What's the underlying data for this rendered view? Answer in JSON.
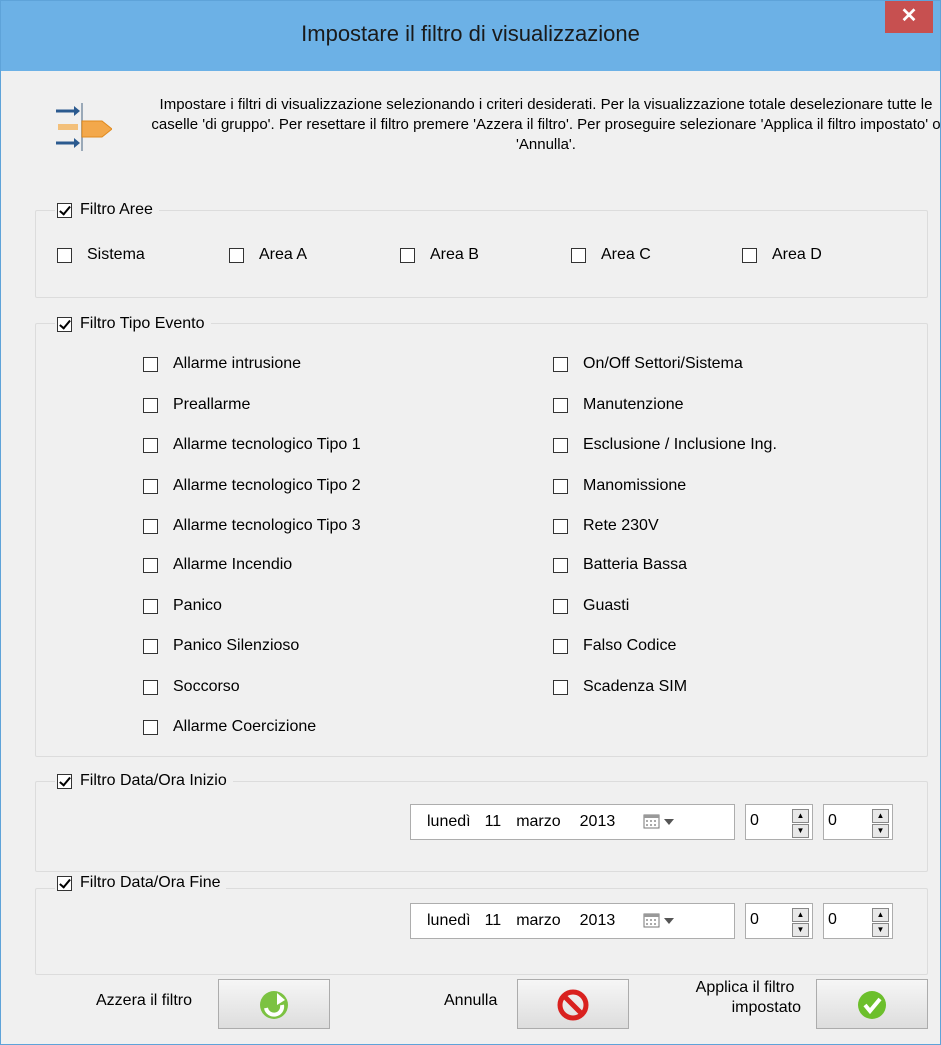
{
  "window": {
    "title": "Impostare il filtro di visualizzazione",
    "close_symbol": "✕"
  },
  "intro": {
    "text": "Impostare i filtri di visualizzazione selezionando i criteri desiderati. Per la visualizzazione totale deselezionare tutte le caselle 'di gruppo'. Per resettare il filtro premere 'Azzera il filtro'. Per proseguire selezionare 'Applica il filtro impostato' o 'Annulla'.",
    "icon": "filter-arrows-icon"
  },
  "filtro_aree": {
    "label": "Filtro Aree",
    "checked": true,
    "items": [
      {
        "label": "Sistema",
        "checked": false
      },
      {
        "label": "Area A",
        "checked": false
      },
      {
        "label": "Area B",
        "checked": false
      },
      {
        "label": "Area C",
        "checked": false
      },
      {
        "label": "Area D",
        "checked": false
      }
    ]
  },
  "filtro_tipo_evento": {
    "label": "Filtro Tipo Evento",
    "checked": true,
    "left_items": [
      {
        "label": "Allarme intrusione",
        "checked": false
      },
      {
        "label": "Preallarme",
        "checked": false
      },
      {
        "label": "Allarme tecnologico Tipo 1",
        "checked": false
      },
      {
        "label": "Allarme tecnologico Tipo 2",
        "checked": false
      },
      {
        "label": "Allarme tecnologico Tipo 3",
        "checked": false
      },
      {
        "label": "Allarme Incendio",
        "checked": false
      },
      {
        "label": "Panico",
        "checked": false
      },
      {
        "label": "Panico Silenzioso",
        "checked": false
      },
      {
        "label": "Soccorso",
        "checked": false
      },
      {
        "label": "Allarme Coercizione",
        "checked": false
      }
    ],
    "right_items": [
      {
        "label": "On/Off Settori/Sistema",
        "checked": false
      },
      {
        "label": "Manutenzione",
        "checked": false
      },
      {
        "label": "Esclusione / Inclusione Ing.",
        "checked": false
      },
      {
        "label": "Manomissione",
        "checked": false
      },
      {
        "label": "Rete 230V",
        "checked": false
      },
      {
        "label": "Batteria Bassa",
        "checked": false
      },
      {
        "label": "Guasti",
        "checked": false
      },
      {
        "label": "Falso Codice",
        "checked": false
      },
      {
        "label": "Scadenza SIM",
        "checked": false
      }
    ]
  },
  "filtro_inizio": {
    "label": "Filtro Data/Ora Inizio",
    "checked": true,
    "weekday": "lunedì",
    "day": "11",
    "month": "marzo",
    "year": "2013",
    "hour": "0",
    "minute": "0"
  },
  "filtro_fine": {
    "label": "Filtro Data/Ora Fine",
    "checked": true,
    "weekday": "lunedì",
    "day": "11",
    "month": "marzo",
    "year": "2013",
    "hour": "0",
    "minute": "0"
  },
  "buttons": {
    "reset_label": "Azzera il filtro",
    "reset_icon": "refresh-arrow-icon",
    "cancel_label": "Annulla",
    "cancel_icon": "no-entry-icon",
    "apply_label_line1": "Applica il filtro",
    "apply_label_line2": "impostato",
    "apply_icon": "checkmark-icon"
  },
  "colors": {
    "titlebar": "#6cb1e6",
    "close": "#c75050",
    "reset_icon": "#7cc242",
    "cancel_icon": "#d9211f",
    "apply_icon": "#6cbf2c",
    "arrow_icon_blue": "#2b5a8f",
    "arrow_icon_orange": "#f3a84b"
  }
}
